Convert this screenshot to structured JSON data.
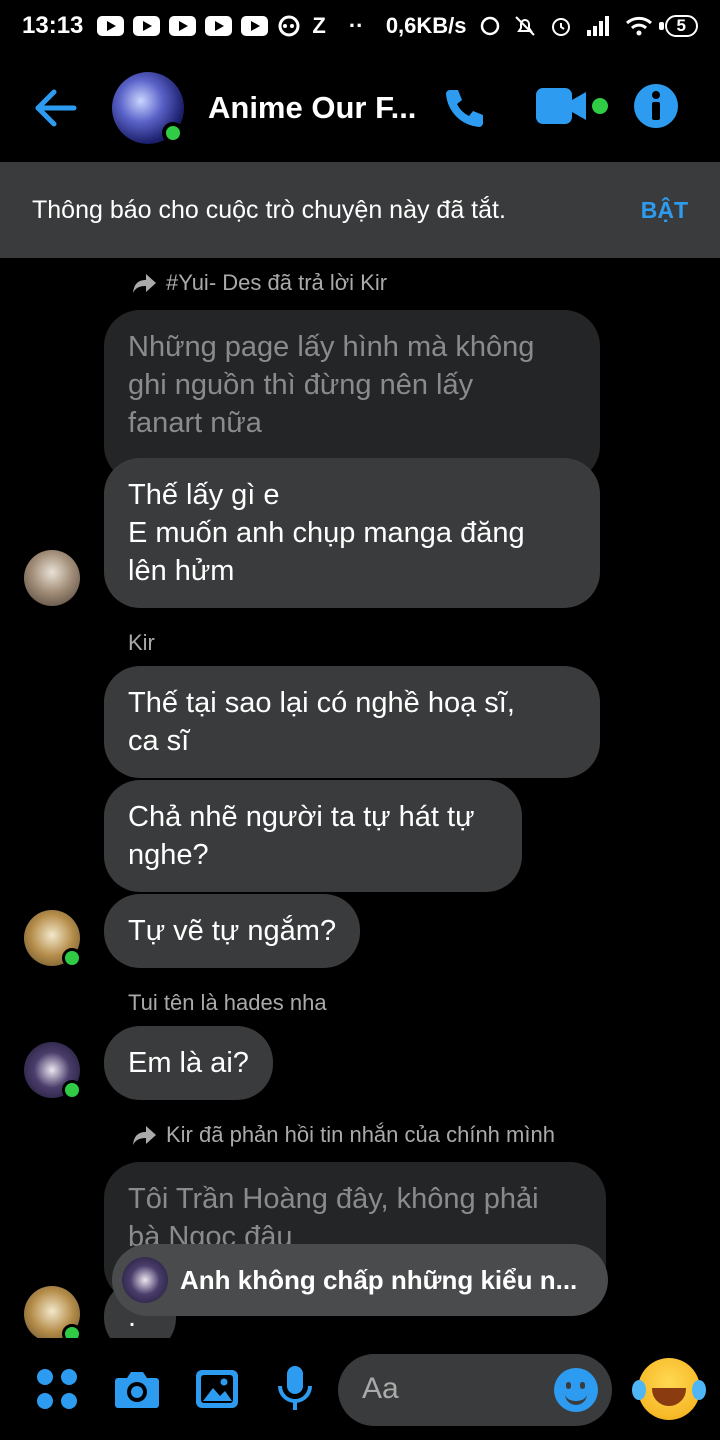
{
  "status_bar": {
    "time": "13:13",
    "z_icon": "Z",
    "dots": "··",
    "net_speed": "0,6KB/s",
    "battery": "5"
  },
  "header": {
    "title": "Anime Our F...",
    "accent_color": "#2d9cf0"
  },
  "notice": {
    "text": "Thông báo cho cuộc trò chuyện này đã tắt.",
    "action": "BẬT"
  },
  "messages": {
    "reply1_meta": "#Yui- Des đã trả lời Kir",
    "quote1": "Những page lấy hình mà không\nghi nguồn thì đừng nên lấy\nfanart nữa",
    "msg1": "Thế lấy gì e\nE muốn anh chụp manga đăng\nlên hửm",
    "sender_kir": "Kir",
    "msg2": "Thế tại sao lại có nghề hoạ sĩ,\nca sĩ",
    "msg3": "Chả nhẽ người ta tự hát tự\nnghe?",
    "msg4": "Tự vẽ tự ngắm?",
    "sender_hades": "Tui tên là hades nha",
    "msg5": "Em là ai?",
    "reply2_meta": "Kir đã phản hồi tin nhắn của chính mình",
    "quote2": "Tôi Trần Hoàng đây, không phải\nbà Ngọc đâu",
    "msg6": "."
  },
  "toast": {
    "text": "Anh không chấp những kiểu n..."
  },
  "composer": {
    "placeholder": "Aa"
  }
}
